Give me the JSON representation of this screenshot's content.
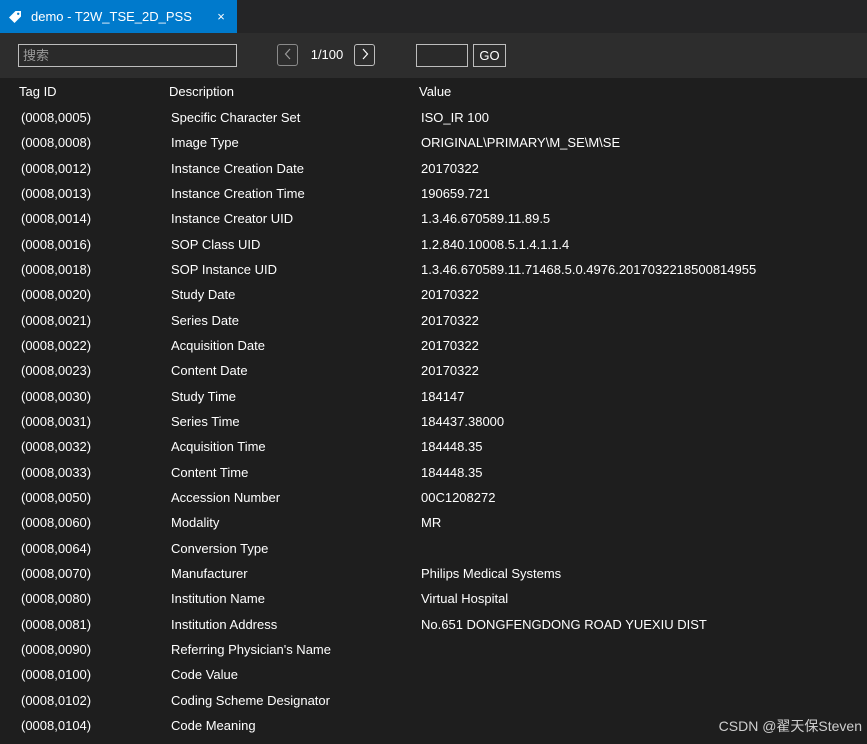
{
  "tab": {
    "title": "demo - T2W_TSE_2D_PSS",
    "close_glyph": "×",
    "icon": "tag-icon"
  },
  "toolbar": {
    "search_placeholder": "搜索",
    "page_label": "1/100",
    "goto_value": "",
    "go_label": "GO"
  },
  "table": {
    "headers": [
      "Tag ID",
      "Description",
      "Value"
    ],
    "rows": [
      {
        "tag": "(0008,0005)",
        "desc": "Specific Character Set",
        "value": "ISO_IR 100"
      },
      {
        "tag": "(0008,0008)",
        "desc": "Image Type",
        "value": "ORIGINAL\\PRIMARY\\M_SE\\M\\SE"
      },
      {
        "tag": "(0008,0012)",
        "desc": "Instance Creation Date",
        "value": "20170322"
      },
      {
        "tag": "(0008,0013)",
        "desc": "Instance Creation Time",
        "value": "190659.721"
      },
      {
        "tag": "(0008,0014)",
        "desc": "Instance Creator UID",
        "value": "1.3.46.670589.11.89.5"
      },
      {
        "tag": "(0008,0016)",
        "desc": "SOP Class UID",
        "value": "1.2.840.10008.5.1.4.1.1.4"
      },
      {
        "tag": "(0008,0018)",
        "desc": "SOP Instance UID",
        "value": "1.3.46.670589.11.71468.5.0.4976.2017032218500814955"
      },
      {
        "tag": "(0008,0020)",
        "desc": "Study Date",
        "value": "20170322"
      },
      {
        "tag": "(0008,0021)",
        "desc": "Series Date",
        "value": "20170322"
      },
      {
        "tag": "(0008,0022)",
        "desc": "Acquisition Date",
        "value": "20170322"
      },
      {
        "tag": "(0008,0023)",
        "desc": "Content Date",
        "value": "20170322"
      },
      {
        "tag": "(0008,0030)",
        "desc": "Study Time",
        "value": "184147"
      },
      {
        "tag": "(0008,0031)",
        "desc": "Series Time",
        "value": "184437.38000"
      },
      {
        "tag": "(0008,0032)",
        "desc": "Acquisition Time",
        "value": "184448.35"
      },
      {
        "tag": "(0008,0033)",
        "desc": "Content Time",
        "value": "184448.35"
      },
      {
        "tag": "(0008,0050)",
        "desc": "Accession Number",
        "value": "00C1208272"
      },
      {
        "tag": "(0008,0060)",
        "desc": "Modality",
        "value": "MR"
      },
      {
        "tag": "(0008,0064)",
        "desc": "Conversion Type",
        "value": ""
      },
      {
        "tag": "(0008,0070)",
        "desc": "Manufacturer",
        "value": "Philips Medical Systems"
      },
      {
        "tag": "(0008,0080)",
        "desc": "Institution Name",
        "value": "Virtual Hospital"
      },
      {
        "tag": "(0008,0081)",
        "desc": "Institution Address",
        "value": "No.651 DONGFENGDONG ROAD YUEXIU DIST"
      },
      {
        "tag": "(0008,0090)",
        "desc": "Referring Physician's Name",
        "value": ""
      },
      {
        "tag": "(0008,0100)",
        "desc": "Code Value",
        "value": ""
      },
      {
        "tag": "(0008,0102)",
        "desc": "Coding Scheme Designator",
        "value": ""
      },
      {
        "tag": "(0008,0104)",
        "desc": "Code Meaning",
        "value": ""
      }
    ]
  },
  "watermark": "CSDN @翟天保Steven",
  "colors": {
    "background": "#1e1e1e",
    "toolbar": "#2d2d2d",
    "tab_active": "#007acc"
  }
}
